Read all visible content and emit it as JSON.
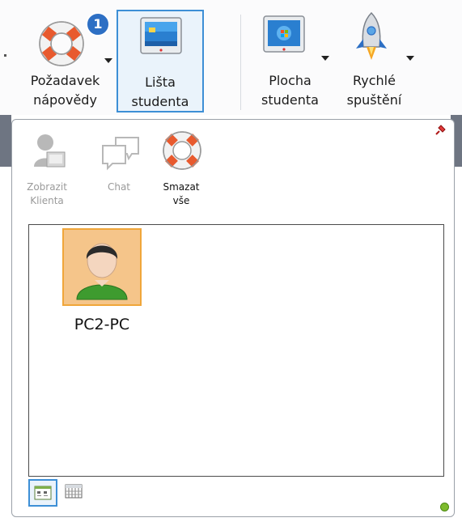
{
  "ribbon": {
    "buttons": [
      {
        "id": "help_request",
        "label_line1": "Požadavek",
        "label_line2": "nápovědy",
        "badge": "1",
        "icon": "lifebuoy-icon",
        "has_dropdown": true
      },
      {
        "id": "student_bar",
        "label_line1": "Lišta",
        "label_line2": "studenta",
        "icon": "monitor-icon",
        "selected": true
      },
      {
        "id": "student_desktop",
        "label_line1": "Plocha",
        "label_line2": "studenta",
        "icon": "monitor-desktop-icon",
        "has_dropdown": true
      },
      {
        "id": "quick_launch",
        "label_line1": "Rychlé",
        "label_line2": "spuštění",
        "icon": "rocket-icon",
        "has_dropdown": true
      }
    ]
  },
  "panel": {
    "tools": [
      {
        "label_line1": "Zobrazit",
        "label_line2": "Klienta",
        "icon": "view-client-icon",
        "enabled": false
      },
      {
        "label_line1": "Chat",
        "label_line2": "",
        "icon": "chat-icon",
        "enabled": false
      },
      {
        "label_line1": "Smazat",
        "label_line2": "vše",
        "icon": "lifebuoy-icon",
        "enabled": true
      }
    ],
    "clients": [
      {
        "name": "PC2-PC",
        "icon": "user-avatar-icon",
        "selected": true
      }
    ],
    "views": [
      {
        "icon": "large-icons-view-icon",
        "active": true
      },
      {
        "icon": "details-view-icon",
        "active": false
      }
    ],
    "status_color": "#7dbb2d"
  }
}
